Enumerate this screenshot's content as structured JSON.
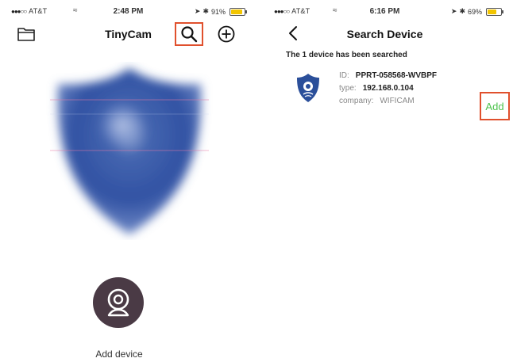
{
  "left_screen": {
    "status": {
      "carrier": "AT&T",
      "time": "2:48 PM",
      "battery": "91%",
      "battery_level": 0.91
    },
    "title": "TinyCam",
    "add_device_label": "Add device"
  },
  "right_screen": {
    "status": {
      "carrier": "AT&T",
      "time": "6:16 PM",
      "battery": "69%",
      "battery_level": 0.69
    },
    "title": "Search Device",
    "search_message": "The 1 device has been searched",
    "device": {
      "id_label": "ID:",
      "id": "PPRT-058568-WVBPF",
      "type_label": "type:",
      "type": "192.168.0.104",
      "company_label": "company:",
      "company": "WIFICAM"
    },
    "add_label": "Add"
  },
  "colors": {
    "highlight_box": "#e0502d",
    "add_green": "#4cc34c",
    "shield_blue": "#3c5aa6",
    "camera_bg": "#4a3a45"
  }
}
